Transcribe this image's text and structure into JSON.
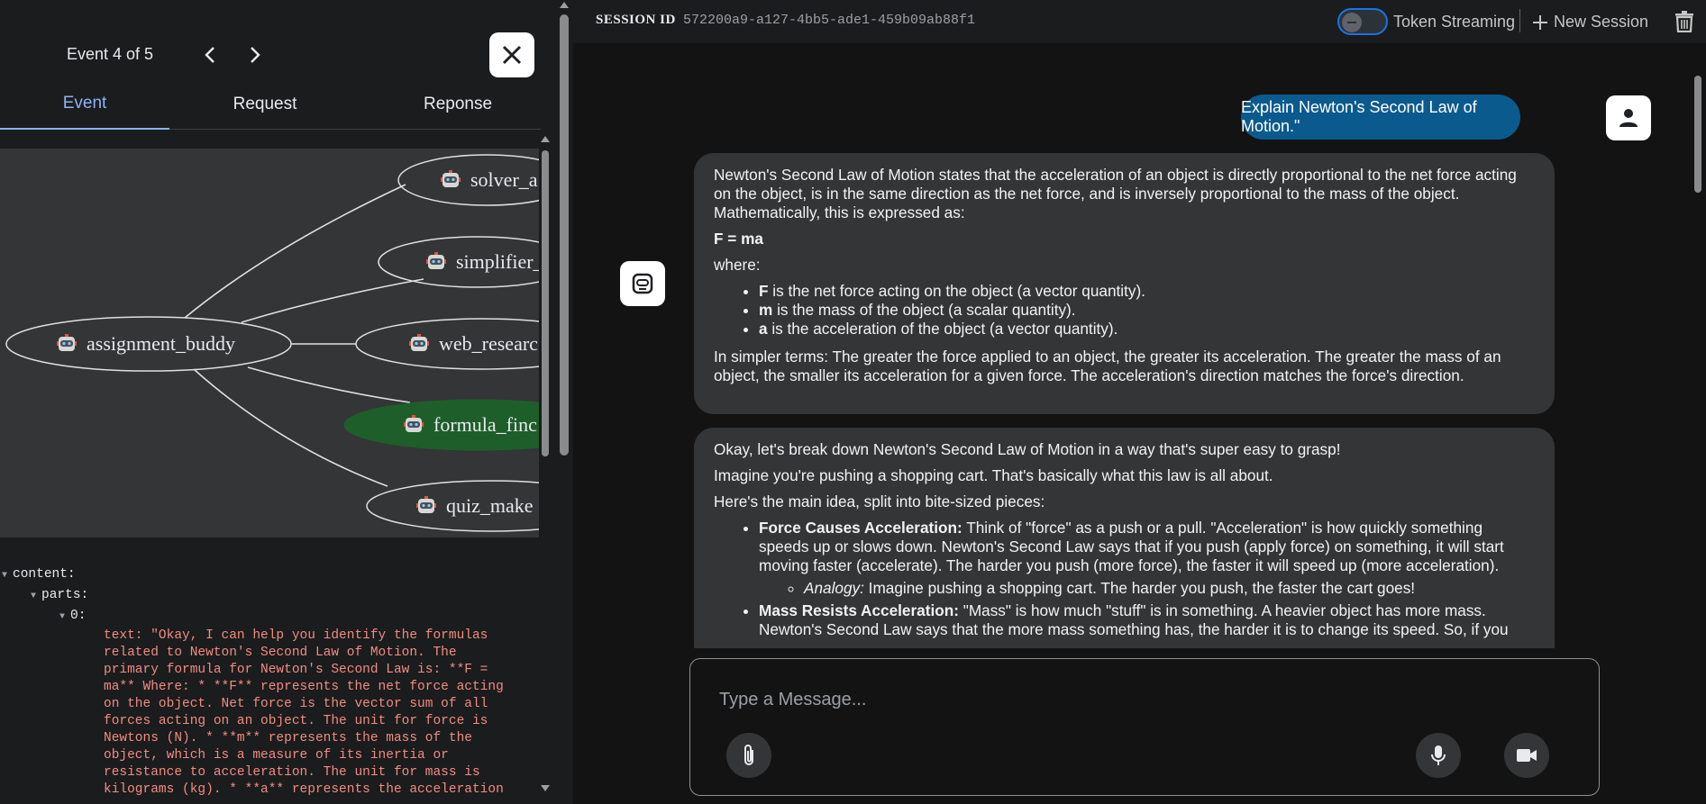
{
  "left_panel": {
    "event_count": "Event 4 of 5",
    "tabs": [
      "Event",
      "Request",
      "Reponse"
    ],
    "graph": {
      "nodes": [
        {
          "label": "solver_a"
        },
        {
          "label": "simplifier_"
        },
        {
          "label": "assignment_buddy"
        },
        {
          "label": "web_researc"
        },
        {
          "label": "formula_finc"
        },
        {
          "label": "quiz_make"
        }
      ],
      "colors": {
        "background": "#333537",
        "highlight": "#1e5e2a",
        "edge": "#e0e0e0"
      }
    },
    "json_view": {
      "k_content": "content:",
      "k_parts": "parts:",
      "k_index": "0:",
      "text_lines": [
        "text: \"Okay, I can help you identify the formulas",
        "related to Newton's Second Law of Motion. The",
        "primary formula for Newton's Second Law is: **F =",
        "ma** Where: * **F** represents the net force acting",
        "on the object. Net force is the vector sum of all",
        "forces acting on an object. The unit for force is",
        "Newtons (N). * **m** represents the mass of the",
        "object, which is a measure of its inertia or",
        "resistance to acceleration. The unit for mass is",
        "kilograms (kg). * **a** represents the acceleration"
      ]
    }
  },
  "topbar": {
    "session_label": "SESSION ID",
    "session_id": "572200a9-a127-4bb5-ade1-459b09ab88f1",
    "token_streaming": "Token Streaming",
    "new_session": "New Session"
  },
  "chat": {
    "user_message": "Explain Newton's Second Law of Motion.\"",
    "msg1": {
      "p1": "Newton's Second Law of Motion states that the acceleration of an object is directly proportional to the net force acting on the object, is in the same direction as the net force, and is inversely proportional to the mass of the object. Mathematically, this is expressed as:",
      "formula": "F = ma",
      "where": "where:",
      "items": [
        {
          "b": "F",
          "t": " is the net force acting on the object (a vector quantity)."
        },
        {
          "b": "m",
          "t": " is the mass of the object (a scalar quantity)."
        },
        {
          "b": "a",
          "t": " is the acceleration of the object (a vector quantity)."
        }
      ],
      "p2": "In simpler terms: The greater the force applied to an object, the greater its acceleration. The greater the mass of an object, the smaller its acceleration for a given force. The acceleration's direction matches the force's direction."
    },
    "msg2": {
      "p1": "Okay, let's break down Newton's Second Law of Motion in a way that's super easy to grasp!",
      "p2": "Imagine you're pushing a shopping cart. That's basically what this law is all about.",
      "p3": "Here's the main idea, split into bite-sized pieces:",
      "item1_b": "Force Causes Acceleration:",
      "item1_t": " Think of \"force\" as a push or a pull. \"Acceleration\" is how quickly something speeds up or slows down. Newton's Second Law says that if you push (apply force) on something, it will start moving faster (accelerate). The harder you push (more force), the faster it will speed up (more acceleration).",
      "sub1_i": "Analogy:",
      "sub1_t": " Imagine pushing a shopping cart. The harder you push, the faster the cart goes!",
      "item2_b": "Mass Resists Acceleration:",
      "item2_t": " \"Mass\" is how much \"stuff\" is in something. A heavier object has more mass. Newton's Second Law says that the more mass something has, the harder it is to change its speed. So, if you"
    },
    "input_placeholder": "Type a Message..."
  }
}
